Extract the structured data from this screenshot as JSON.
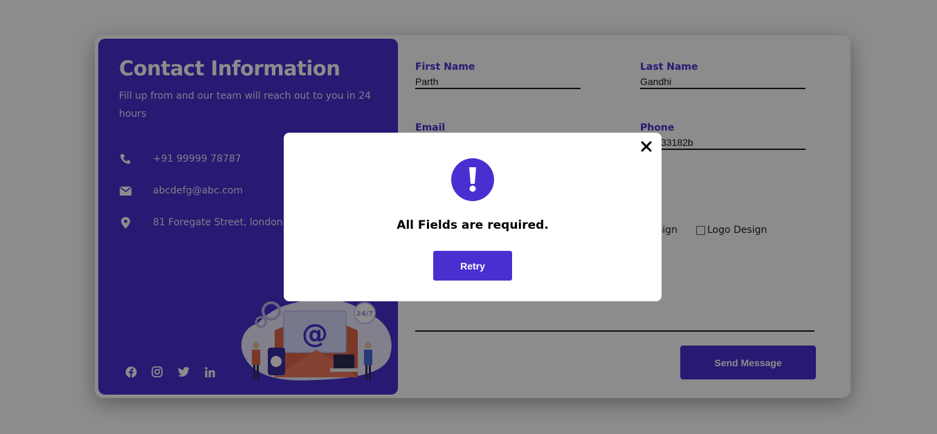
{
  "colors": {
    "accent": "#4a2fd0",
    "overlay": "rgba(0,0,0,0.45)"
  },
  "info": {
    "title": "Contact Information",
    "subtitle": "Fill up from and our team will reach out to you in 24 hours",
    "items": [
      {
        "icon": "phone-icon",
        "text": "+91 99999 78787"
      },
      {
        "icon": "envelope-icon",
        "text": "abcdefg@abc.com"
      },
      {
        "icon": "map-pin-icon",
        "text": "81 Foregate Street, london"
      }
    ],
    "socials": [
      "facebook-icon",
      "instagram-icon",
      "twitter-icon",
      "linkedin-icon"
    ],
    "illustration_badge": "24/7"
  },
  "form": {
    "first_name": {
      "label": "First Name",
      "value": "Parth"
    },
    "last_name": {
      "label": "Last Name",
      "value": "Gandhi"
    },
    "email": {
      "label": "Email",
      "value": ""
    },
    "phone": {
      "label": "Phone",
      "value": "33182b"
    },
    "checkboxes": [
      {
        "label": "sign",
        "checked": false
      },
      {
        "label": "Logo Design",
        "checked": false
      }
    ],
    "send_label": "Send Message"
  },
  "modal": {
    "icon": "exclamation-icon",
    "message": "All Fields are required.",
    "retry_label": "Retry",
    "close_icon": "close-icon"
  }
}
